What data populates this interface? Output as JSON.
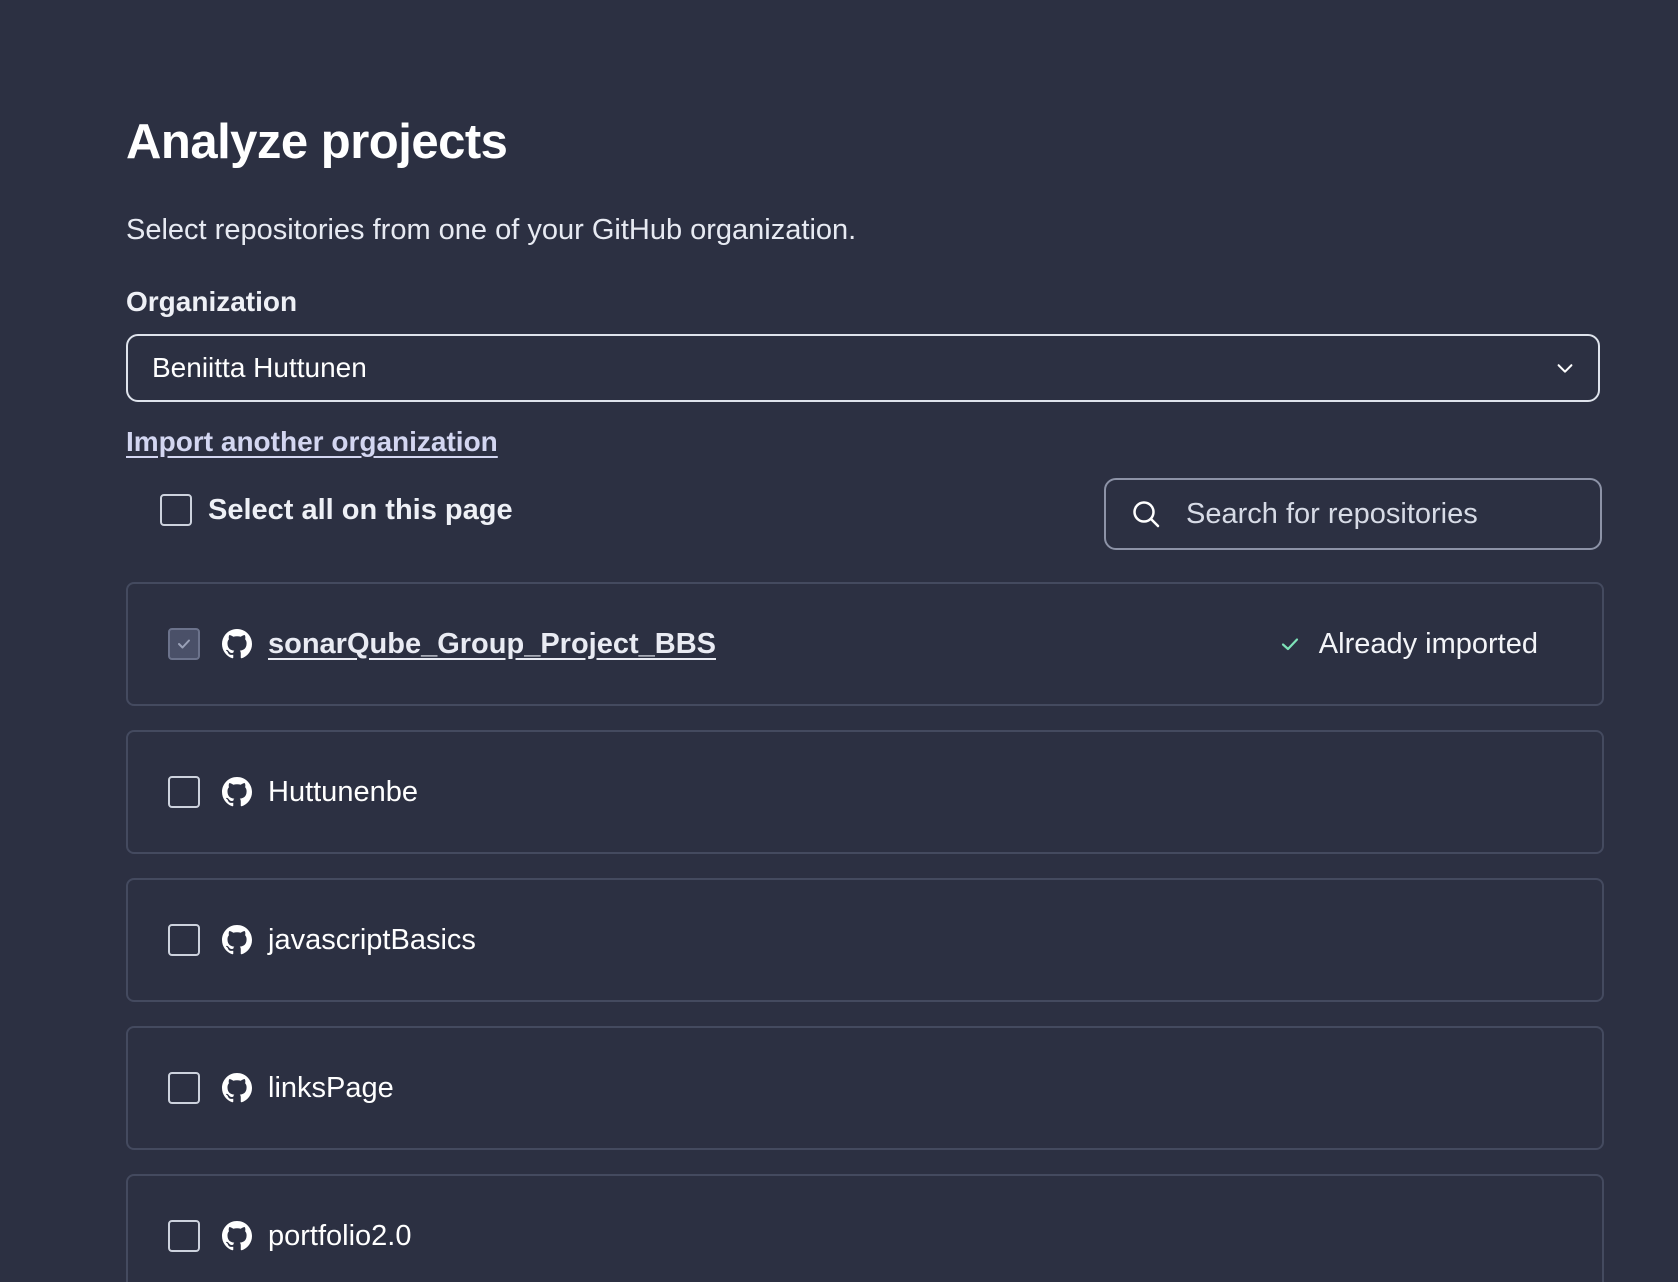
{
  "page": {
    "title": "Analyze projects",
    "subtitle": "Select repositories from one of your GitHub organization.",
    "colors": {
      "background": "#2c3042",
      "link": "#d3d6f1",
      "success": "#7ee2b8"
    }
  },
  "organization": {
    "label": "Organization",
    "selected": "Beniitta Huttunen",
    "dropdown_icon": "chevron-down-icon"
  },
  "import_link": "Import another organization",
  "select_all": {
    "label": "Select all on this page",
    "checked": false
  },
  "search": {
    "placeholder": "Search for repositories",
    "value": "",
    "icon": "search-icon"
  },
  "repositories": [
    {
      "name": "sonarQube_Group_Project_BBS",
      "checked": true,
      "disabled": true,
      "status": "Already imported",
      "icon": "github-icon"
    },
    {
      "name": "Huttunenbe",
      "checked": false,
      "disabled": false,
      "icon": "github-icon"
    },
    {
      "name": "javascriptBasics",
      "checked": false,
      "disabled": false,
      "icon": "github-icon"
    },
    {
      "name": "linksPage",
      "checked": false,
      "disabled": false,
      "icon": "github-icon"
    },
    {
      "name": "portfolio2.0",
      "checked": false,
      "disabled": false,
      "icon": "github-icon"
    }
  ]
}
